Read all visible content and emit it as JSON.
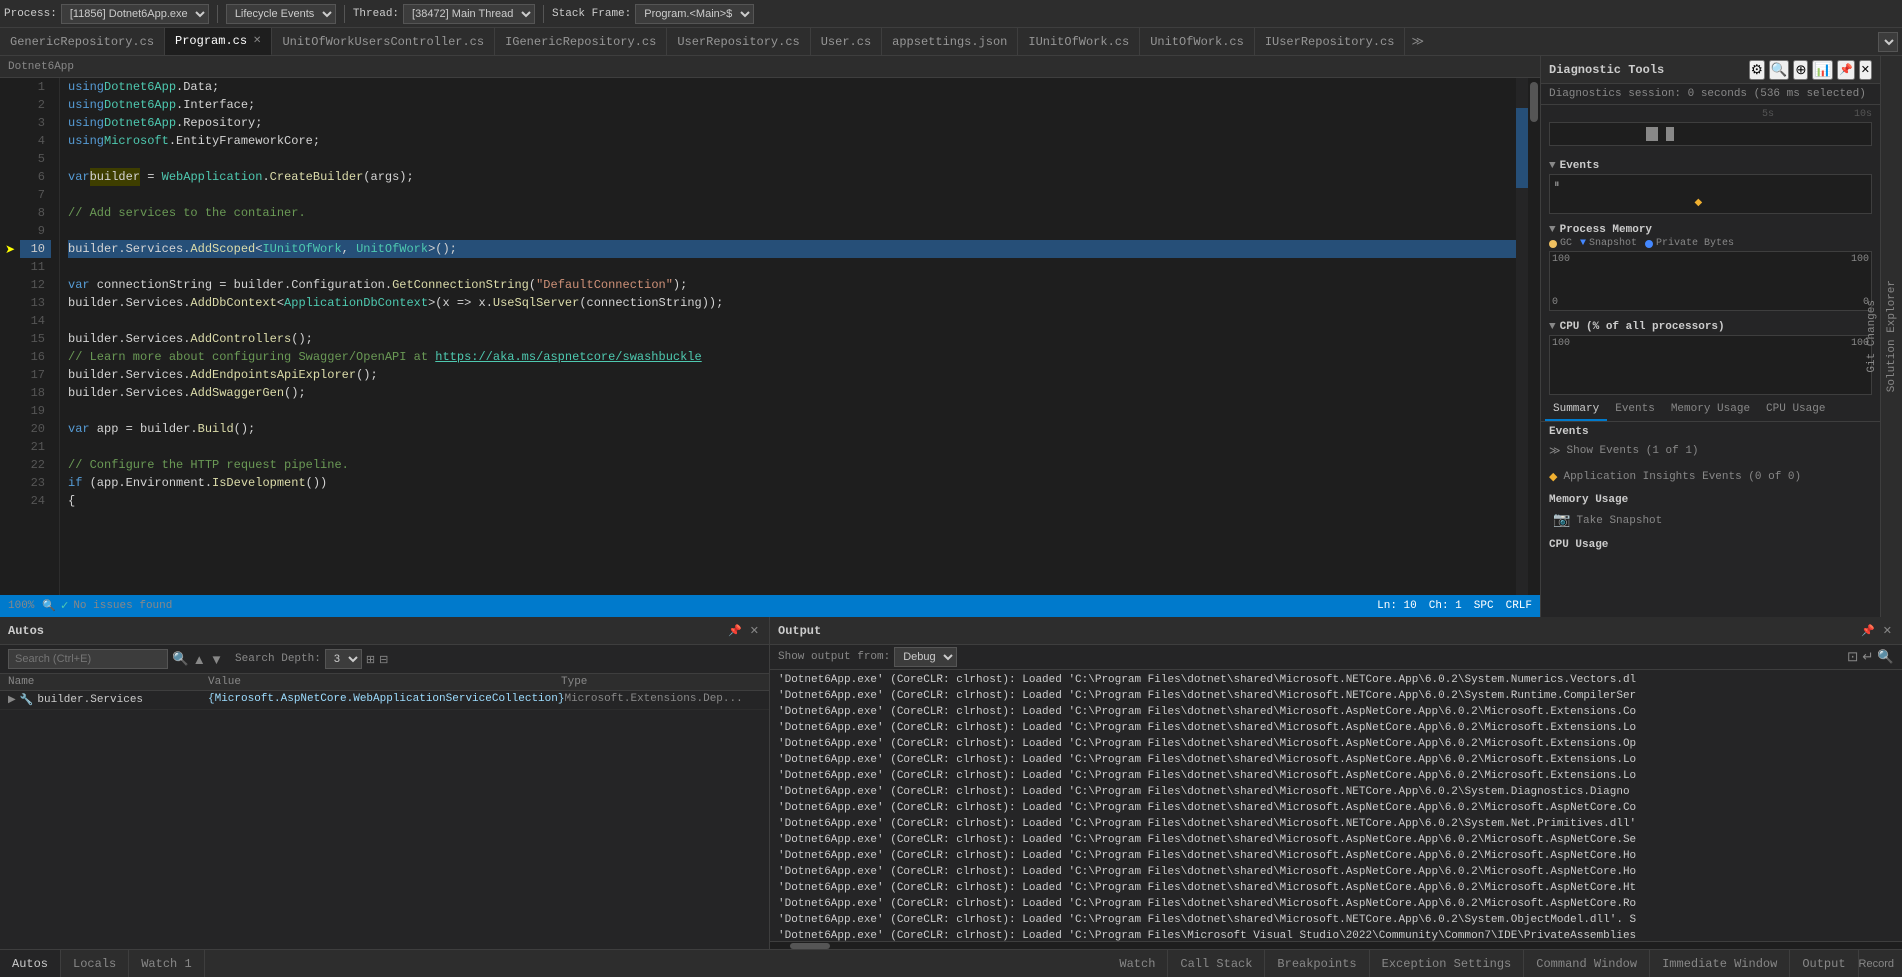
{
  "toolbar": {
    "process_label": "Process:",
    "process_value": "[11856] Dotnet6App.exe",
    "lifecycle_label": "Lifecycle Events",
    "thread_label": "Thread:",
    "thread_value": "[38472] Main Thread",
    "stack_frame_label": "Stack Frame:",
    "stack_frame_value": "Program.<Main>$"
  },
  "tabs": [
    {
      "label": "GenericRepository.cs",
      "active": false,
      "closable": false
    },
    {
      "label": "Program.cs",
      "active": true,
      "closable": true
    },
    {
      "label": "UnitOfWorkUsersController.cs",
      "active": false,
      "closable": false
    },
    {
      "label": "IGenericRepository.cs",
      "active": false,
      "closable": false
    },
    {
      "label": "UserRepository.cs",
      "active": false,
      "closable": false
    },
    {
      "label": "User.cs",
      "active": false,
      "closable": false
    },
    {
      "label": "appsettings.json",
      "active": false,
      "closable": false
    },
    {
      "label": "IUnitOfWork.cs",
      "active": false,
      "closable": false
    },
    {
      "label": "UnitOfWork.cs",
      "active": false,
      "closable": false
    },
    {
      "label": "IUserRepository.cs",
      "active": false,
      "closable": false
    }
  ],
  "breadcrumb": "Dotnet6App",
  "code_lines": [
    {
      "num": 1,
      "text": "using Dotnet6App.Data;",
      "type": "normal"
    },
    {
      "num": 2,
      "text": "using Dotnet6App.Interface;",
      "type": "normal"
    },
    {
      "num": 3,
      "text": "using Dotnet6App.Repository;",
      "type": "normal"
    },
    {
      "num": 4,
      "text": "using Microsoft.EntityFrameworkCore;",
      "type": "normal"
    },
    {
      "num": 5,
      "text": "",
      "type": "normal"
    },
    {
      "num": 6,
      "text": "var builder = WebApplication.CreateBuilder(args);",
      "type": "normal"
    },
    {
      "num": 7,
      "text": "",
      "type": "normal"
    },
    {
      "num": 8,
      "text": "// Add services to the container.",
      "type": "comment"
    },
    {
      "num": 9,
      "text": "",
      "type": "normal"
    },
    {
      "num": 10,
      "text": "builder.Services.AddScoped<IUnitOfWork, UnitOfWork>();",
      "type": "highlighted"
    },
    {
      "num": 11,
      "text": "",
      "type": "normal"
    },
    {
      "num": 12,
      "text": "var connectionString = builder.Configuration.GetConnectionString(\"DefaultConnection\");",
      "type": "normal"
    },
    {
      "num": 13,
      "text": "builder.Services.AddDbContext<ApplicationDbContext>(x => x.UseSqlServer(connectionString));",
      "type": "normal"
    },
    {
      "num": 14,
      "text": "",
      "type": "normal"
    },
    {
      "num": 15,
      "text": "builder.Services.AddControllers();",
      "type": "normal"
    },
    {
      "num": 16,
      "text": "// Learn more about configuring Swagger/OpenAPI at https://aka.ms/aspnetcore/swashbuckle",
      "type": "comment"
    },
    {
      "num": 17,
      "text": "builder.Services.AddEndpointsApiExplorer();",
      "type": "normal"
    },
    {
      "num": 18,
      "text": "builder.Services.AddSwaggerGen();",
      "type": "normal"
    },
    {
      "num": 19,
      "text": "",
      "type": "normal"
    },
    {
      "num": 20,
      "text": "var app = builder.Build();",
      "type": "normal"
    },
    {
      "num": 21,
      "text": "",
      "type": "normal"
    },
    {
      "num": 22,
      "text": "// Configure the HTTP request pipeline.",
      "type": "comment"
    },
    {
      "num": 23,
      "text": "if (app.Environment.IsDevelopment())",
      "type": "normal"
    },
    {
      "num": 24,
      "text": "{",
      "type": "normal"
    }
  ],
  "status": {
    "zoom": "100%",
    "issues": "No issues found",
    "ln": "Ln: 10",
    "ch": "Ch: 1",
    "encoding": "SPC",
    "line_ending": "CRLF"
  },
  "diagnostic_tools": {
    "title": "Diagnostic Tools",
    "session_info": "Diagnostics session: 0 seconds (536 ms selected)",
    "timeline_labels": [
      "5s",
      "10s"
    ],
    "events_header": "Events",
    "events_count": "Show Events (1 of 1)",
    "app_insights": "Application Insights Events (0 of 0)",
    "memory_header": "Process Memory",
    "gc_label": "GC",
    "snapshot_label": "Snapshot",
    "private_label": "Private Bytes",
    "memory_max": "100",
    "memory_zero": "0",
    "cpu_header": "CPU (% of all processors)",
    "cpu_max": "100",
    "cpu_max2": "100",
    "tabs": [
      "Summary",
      "Events",
      "Memory Usage",
      "CPU Usage"
    ],
    "active_tab": "Summary",
    "take_snapshot": "Take Snapshot"
  },
  "autos_panel": {
    "title": "Autos",
    "search_placeholder": "Search (Ctrl+E)",
    "search_depth_label": "Search Depth:",
    "search_depth_value": "3",
    "columns": [
      "Name",
      "Value",
      "Type"
    ],
    "rows": [
      {
        "expand": true,
        "name": "builder.Services",
        "value": "{Microsoft.AspNetCore.WebApplicationServiceCollection}",
        "type": "Microsoft.Extensions.Dep..."
      }
    ]
  },
  "bottom_tabs": [
    {
      "label": "Autos",
      "active": true
    },
    {
      "label": "Locals",
      "active": false
    },
    {
      "label": "Watch 1",
      "active": false
    },
    {
      "label": "Watch",
      "active": false
    },
    {
      "label": "Call Stack",
      "active": false
    },
    {
      "label": "Breakpoints",
      "active": false
    },
    {
      "label": "Exception Settings",
      "active": false
    },
    {
      "label": "Command Window",
      "active": false
    },
    {
      "label": "Immediate Window",
      "active": false
    },
    {
      "label": "Output",
      "active": false
    }
  ],
  "output_panel": {
    "title": "Output",
    "show_output_label": "Show output from:",
    "source": "Debug",
    "lines": [
      "'Dotnet6App.exe' (CoreCLR: clrhost): Loaded 'C:\\Program Files\\dotnet\\shared\\Microsoft.NETCore.App\\6.0.2\\System.Numerics.Vectors.dl",
      "'Dotnet6App.exe' (CoreCLR: clrhost): Loaded 'C:\\Program Files\\dotnet\\shared\\Microsoft.NETCore.App\\6.0.2\\System.Runtime.CompilerSer",
      "'Dotnet6App.exe' (CoreCLR: clrhost): Loaded 'C:\\Program Files\\dotnet\\shared\\Microsoft.AspNetCore.App\\6.0.2\\Microsoft.Extensions.Co",
      "'Dotnet6App.exe' (CoreCLR: clrhost): Loaded 'C:\\Program Files\\dotnet\\shared\\Microsoft.AspNetCore.App\\6.0.2\\Microsoft.Extensions.Lo",
      "'Dotnet6App.exe' (CoreCLR: clrhost): Loaded 'C:\\Program Files\\dotnet\\shared\\Microsoft.AspNetCore.App\\6.0.2\\Microsoft.Extensions.Op",
      "'Dotnet6App.exe' (CoreCLR: clrhost): Loaded 'C:\\Program Files\\dotnet\\shared\\Microsoft.AspNetCore.App\\6.0.2\\Microsoft.Extensions.Lo",
      "'Dotnet6App.exe' (CoreCLR: clrhost): Loaded 'C:\\Program Files\\dotnet\\shared\\Microsoft.AspNetCore.App\\6.0.2\\Microsoft.Extensions.Lo",
      "'Dotnet6App.exe' (CoreCLR: clrhost): Loaded 'C:\\Program Files\\dotnet\\shared\\Microsoft.NETCore.App\\6.0.2\\System.Diagnostics.Diagno",
      "'Dotnet6App.exe' (CoreCLR: clrhost): Loaded 'C:\\Program Files\\dotnet\\shared\\Microsoft.AspNetCore.App\\6.0.2\\Microsoft.AspNetCore.Co",
      "'Dotnet6App.exe' (CoreCLR: clrhost): Loaded 'C:\\Program Files\\dotnet\\shared\\Microsoft.NETCore.App\\6.0.2\\System.Net.Primitives.dll'",
      "'Dotnet6App.exe' (CoreCLR: clrhost): Loaded 'C:\\Program Files\\dotnet\\shared\\Microsoft.AspNetCore.App\\6.0.2\\Microsoft.AspNetCore.Se",
      "'Dotnet6App.exe' (CoreCLR: clrhost): Loaded 'C:\\Program Files\\dotnet\\shared\\Microsoft.AspNetCore.App\\6.0.2\\Microsoft.AspNetCore.Ho",
      "'Dotnet6App.exe' (CoreCLR: clrhost): Loaded 'C:\\Program Files\\dotnet\\shared\\Microsoft.AspNetCore.App\\6.0.2\\Microsoft.AspNetCore.Ho",
      "'Dotnet6App.exe' (CoreCLR: clrhost): Loaded 'C:\\Program Files\\dotnet\\shared\\Microsoft.AspNetCore.App\\6.0.2\\Microsoft.AspNetCore.Ht",
      "'Dotnet6App.exe' (CoreCLR: clrhost): Loaded 'C:\\Program Files\\dotnet\\shared\\Microsoft.AspNetCore.App\\6.0.2\\Microsoft.AspNetCore.Ro",
      "'Dotnet6App.exe' (CoreCLR: clrhost): Loaded 'C:\\Program Files\\dotnet\\shared\\Microsoft.NETCore.App\\6.0.2\\System.ObjectModel.dll'. S",
      "'Dotnet6App.exe' (CoreCLR: clrhost): Loaded 'C:\\Program Files\\Microsoft Visual Studio\\2022\\Community\\Common7\\IDE\\PrivateAssemblies"
    ]
  },
  "solution_panel": {
    "solution_tab": "Solution Explorer",
    "git_tab": "Git Changes"
  },
  "icons": {
    "pin": "📌",
    "close": "✕",
    "search": "🔍",
    "arrow_up": "▲",
    "arrow_down": "▼",
    "expand": "▶",
    "collapse": "▼",
    "settings": "⚙",
    "camera": "📷",
    "play": "▶",
    "pause": "⏸",
    "stop": "⏹"
  }
}
